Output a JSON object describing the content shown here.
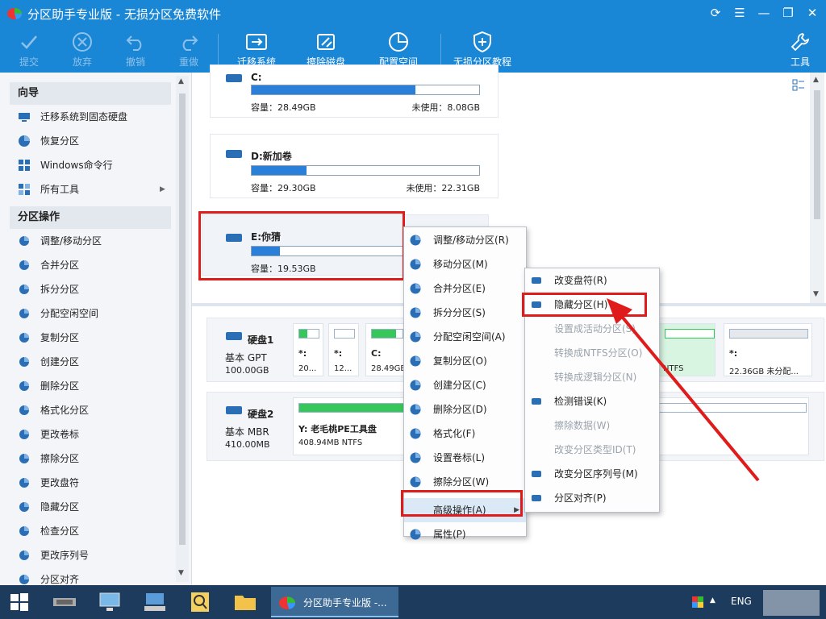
{
  "window": {
    "title": "分区助手专业版 - 无损分区免费软件"
  },
  "toolbar": {
    "commit": "提交",
    "discard": "放弃",
    "undo": "撤销",
    "redo": "重做",
    "migrate": "迁移系统",
    "wipe": "擦除磁盘",
    "allocate": "配置空间",
    "tutorial": "无损分区教程",
    "tools": "工具"
  },
  "sidebar": {
    "wizard_title": "向导",
    "wizard_items": [
      "迁移系统到固态硬盘",
      "恢复分区",
      "Windows命令行",
      "所有工具"
    ],
    "ops_title": "分区操作",
    "ops_items": [
      "调整/移动分区",
      "合并分区",
      "拆分分区",
      "分配空闲空间",
      "复制分区",
      "创建分区",
      "删除分区",
      "格式化分区",
      "更改卷标",
      "擦除分区",
      "更改盘符",
      "隐藏分区",
      "检查分区",
      "更改序列号",
      "分区对齐"
    ]
  },
  "partitions": [
    {
      "name": "C:",
      "cap": "容量：28.49GB",
      "free": "未使用：8.08GB",
      "used_fraction": 0.72
    },
    {
      "name": "D:新加卷",
      "cap": "容量：29.30GB",
      "free": "未使用：22.31GB",
      "used_fraction": 0.24
    },
    {
      "name": "E:你猜",
      "cap": "容量：19.53GB",
      "free": "",
      "used_fraction": 0.18
    }
  ],
  "disks": [
    {
      "name": "硬盘1",
      "type": "基本 GPT",
      "size": "100.00GB",
      "parts": [
        {
          "label": "*:",
          "size": "20...",
          "used_fraction": 0.4
        },
        {
          "label": "*:",
          "size": "12...",
          "used_fraction": 0.0
        },
        {
          "label": "C:",
          "size": "28.49GB",
          "used_fraction": 0.8
        },
        {
          "label": "*:",
          "size": "22.36GB 未分配...",
          "used_fraction": 0.0
        }
      ],
      "ntfs_label": "NTFS"
    },
    {
      "name": "硬盘2",
      "type": "基本 MBR",
      "size": "410.00MB",
      "parts": [
        {
          "label": "Y: 老毛桃PE工具盘",
          "size": "408.94MB NTFS",
          "used_fraction": 0.23
        }
      ]
    }
  ],
  "context_menu": {
    "items": [
      "调整/移动分区(R)",
      "移动分区(M)",
      "合并分区(E)",
      "拆分分区(S)",
      "分配空闲空间(A)",
      "复制分区(O)",
      "创建分区(C)",
      "删除分区(D)",
      "格式化(F)",
      "设置卷标(L)",
      "擦除分区(W)",
      "高级操作(A)",
      "属性(P)"
    ]
  },
  "submenu": {
    "items": [
      {
        "label": "改变盘符(R)",
        "enabled": true
      },
      {
        "label": "隐藏分区(H)",
        "enabled": true
      },
      {
        "label": "设置成活动分区(S)",
        "enabled": false
      },
      {
        "label": "转换成NTFS分区(O)",
        "enabled": false
      },
      {
        "label": "转换成逻辑分区(N)",
        "enabled": false
      },
      {
        "label": "检测错误(K)",
        "enabled": true
      },
      {
        "label": "擦除数据(W)",
        "enabled": false
      },
      {
        "label": "改变分区类型ID(T)",
        "enabled": false
      },
      {
        "label": "改变分区序列号(M)",
        "enabled": true
      },
      {
        "label": "分区对齐(P)",
        "enabled": true
      }
    ]
  },
  "taskbar": {
    "active_app": "分区助手专业版 -...",
    "lang": "ENG"
  },
  "colors": {
    "accent": "#1a86d6",
    "highlight": "#e01b1b",
    "bar_used": "#2a80d8",
    "disk_used": "#35c759"
  }
}
